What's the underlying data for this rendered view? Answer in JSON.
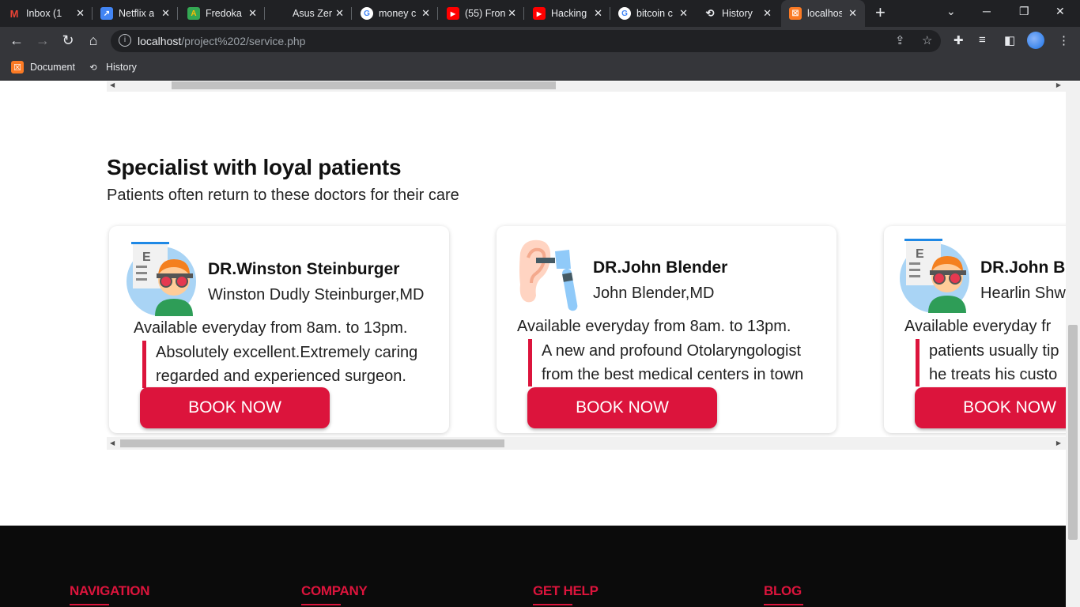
{
  "browser": {
    "tabs": [
      {
        "title": "Inbox (1",
        "icon": "gmail-icon",
        "color": "#ea4335"
      },
      {
        "title": "Netflix a",
        "icon": "chart-app-icon",
        "color": "#4285f4"
      },
      {
        "title": "Fredoka",
        "icon": "fonts-icon",
        "color": "#fbbc04"
      },
      {
        "title": "Asus Zer",
        "icon": "blank-page-icon",
        "color": "#202124"
      },
      {
        "title": "money c",
        "icon": "google-icon",
        "color": "#ffffff"
      },
      {
        "title": "(55) Fron",
        "icon": "youtube-icon",
        "color": "#ff0000"
      },
      {
        "title": "Hacking",
        "icon": "youtube-icon",
        "color": "#ff0000"
      },
      {
        "title": "bitcoin c",
        "icon": "google-icon",
        "color": "#ffffff"
      },
      {
        "title": "History",
        "icon": "history-icon",
        "color": "#e8eaed"
      },
      {
        "title": "localhost",
        "icon": "xampp-icon",
        "color": "#fb7a24"
      }
    ],
    "new_tab_glyph": "+",
    "url_host": "localhost",
    "url_path": "/project%202/service.php",
    "bookmarks": [
      {
        "label": "Document",
        "icon": "xampp-icon"
      },
      {
        "label": "History",
        "icon": "history-icon"
      }
    ]
  },
  "section": {
    "title": "Specialist with loyal patients",
    "subtitle": "Patients often return to these doctors for their care"
  },
  "doctors": [
    {
      "name": "DR.Winston Steinburger",
      "full_name": "Winston Dudly Steinburger,MD",
      "availability": "Available everyday from 8am. to 13pm.",
      "quote_line1": "Absolutely excellent.Extremely caring",
      "quote_line2": "regarded and experienced surgeon.",
      "button": "BOOK NOW",
      "avatar": "ophthalmologist-avatar-icon"
    },
    {
      "name": "DR.John Blender",
      "full_name": "John Blender,MD",
      "availability": "Available everyday from 8am. to 13pm.",
      "quote_line1": "A new and profound Otolaryngologist",
      "quote_line2": "from the best medical centers in town",
      "button": "BOOK NOW",
      "avatar": "otoscope-ear-icon"
    },
    {
      "name": "DR.John Bl",
      "full_name": "Hearlin Shw",
      "availability": "Available everyday fr",
      "quote_line1": "patients usually tip",
      "quote_line2": "he treats his custo",
      "button": "BOOK NOW",
      "avatar": "ophthalmologist-avatar-icon"
    }
  ],
  "footer": {
    "columns": [
      "NAVIGATION",
      "COMPANY",
      "GET HELP",
      "BLOG"
    ]
  },
  "colors": {
    "accent": "#dc143c",
    "footer_bg": "#0b0b0b",
    "chrome_dark": "#202124",
    "chrome_toolbar": "#35363a"
  }
}
